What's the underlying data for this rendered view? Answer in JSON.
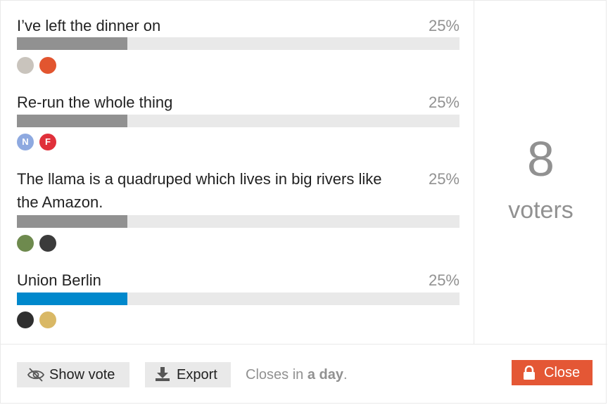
{
  "poll": {
    "options": [
      {
        "text": "I’ve left the dinner on",
        "percent_label": "25%",
        "percent": 25,
        "fill_color": "#919191",
        "voters": [
          {
            "name": "voter-avatar-1",
            "bg": "#c9c4bd",
            "letter": ""
          },
          {
            "name": "voter-avatar-2",
            "bg": "#e2552f",
            "letter": ""
          }
        ]
      },
      {
        "text": "Re-run the whole thing",
        "percent_label": "25%",
        "percent": 25,
        "fill_color": "#919191",
        "voters": [
          {
            "name": "voter-avatar-3",
            "bg": "#8ea9e0",
            "letter": "N"
          },
          {
            "name": "voter-avatar-4",
            "bg": "#e0303a",
            "letter": "F"
          }
        ]
      },
      {
        "text": "The llama is a quadruped which lives in big rivers like the Amazon.",
        "percent_label": "25%",
        "percent": 25,
        "fill_color": "#919191",
        "voters": [
          {
            "name": "voter-avatar-5",
            "bg": "#6e8a4e",
            "letter": ""
          },
          {
            "name": "voter-avatar-6",
            "bg": "#3b3b3b",
            "letter": ""
          }
        ]
      },
      {
        "text": "Union Berlin",
        "percent_label": "25%",
        "percent": 25,
        "fill_color": "#0088cc",
        "voters": [
          {
            "name": "voter-avatar-7",
            "bg": "#2f2f2f",
            "letter": ""
          },
          {
            "name": "voter-avatar-8",
            "bg": "#d9b865",
            "letter": ""
          }
        ]
      }
    ],
    "voters_count": "8",
    "voters_label": "voters"
  },
  "footer": {
    "show_vote_label": "Show vote",
    "export_label": "Export",
    "closes_prefix": "Closes in ",
    "closes_bold": "a day",
    "closes_suffix": ".",
    "close_label": "Close"
  },
  "icons": {
    "show_vote": "eye-slash-icon",
    "export": "download-icon",
    "close": "lock-icon"
  },
  "colors": {
    "accent": "#0088cc",
    "bar_track": "#e9e9e9",
    "bar_fill": "#919191",
    "danger": "#e45735"
  }
}
